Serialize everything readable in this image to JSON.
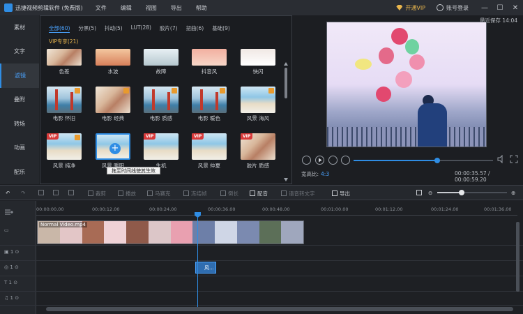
{
  "app": {
    "title": "迅捷视频剪辑软件 (免费版)",
    "menu": [
      "文件",
      "编辑",
      "视图",
      "导出",
      "帮助"
    ],
    "vip": "开通VIP",
    "login": "账号登录",
    "last_save": "最近保存 14:04"
  },
  "window": {
    "min": "—",
    "max": "☐",
    "close": "✕"
  },
  "nav": [
    "素材",
    "文字",
    "滤镜",
    "叠附",
    "转场",
    "动画",
    "配乐"
  ],
  "filter_panel": {
    "tabs": [
      "全部(60)",
      "分黑(5)",
      "抖动(5)",
      "LUT(28)",
      "胶片(7)",
      "扭曲(6)",
      "基础(9)"
    ],
    "vip_section": "VIP专享(21)",
    "row0": [
      "色差",
      "水波",
      "故障",
      "抖音风",
      "快闪"
    ],
    "row1": [
      "电影 怀旧",
      "电影 经典",
      "电影 质感",
      "电影 暖色",
      "风景 海风"
    ],
    "row2": [
      "风景 纯净",
      "风景 暖阳",
      "生机",
      "风景 仲夏",
      "胶片 质感"
    ],
    "tooltip": "拖至时间线使其生效"
  },
  "preview": {
    "ratio_label": "宽高比:",
    "ratio_value": "4:3",
    "time": "00:00:35.57 / 00:00:59.20",
    "progress": 0.6
  },
  "toolbar": {
    "crop": "裁剪",
    "speed": "播放",
    "mosaic": "马赛克",
    "freeze": "冻结帧",
    "countdown": "倒长",
    "dub": "配音",
    "speech": "语音转文字",
    "export": "导出",
    "zoom": 0.35
  },
  "timeline": {
    "ticks": [
      "00:00:00.00",
      "00:00:12.00",
      "00:00:24.00",
      "00:00:36.00",
      "00:00:48.00",
      "00:01:00.00",
      "00:01:12.00",
      "00:01:24.00",
      "00:01:36.00"
    ],
    "clip_name": "Normal Video.mp4",
    "mini_clip": "风...",
    "track_num": "1"
  },
  "colors": {
    "accent": "#2f8de4",
    "vip": "#e8b54d"
  }
}
